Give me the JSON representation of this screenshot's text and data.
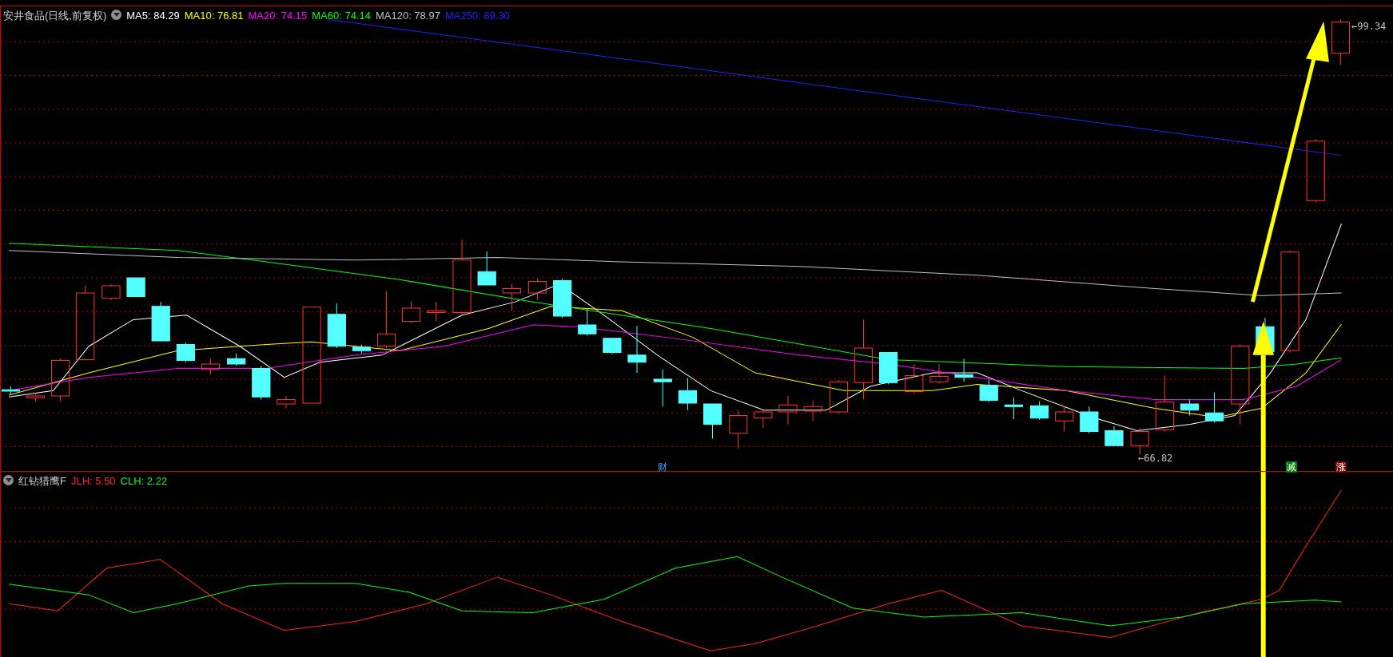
{
  "chart_title": "安井食品(日线,前复权)",
  "moving_averages": [
    {
      "label": "MA5: 84.29",
      "color": "#ffffff"
    },
    {
      "label": "MA10: 76.81",
      "color": "#ffff00"
    },
    {
      "label": "MA20: 74.15",
      "color": "#ff00ff"
    },
    {
      "label": "MA60: 74.14",
      "color": "#00ff00"
    },
    {
      "label": "MA120: 78.97",
      "color": "#c0c0c0"
    },
    {
      "label": "MA250: 89.30",
      "color": "#2020ff"
    }
  ],
  "price_labels": {
    "high": "←99.34",
    "low": "←66.82"
  },
  "event_markers": [
    {
      "label": "财",
      "kind": "finance"
    },
    {
      "label": "减",
      "kind": "reduce"
    },
    {
      "label": "涨",
      "kind": "rise"
    }
  ],
  "indicator": {
    "name": "红钻猎鹰F",
    "values": [
      {
        "label": "JLH: 5.50",
        "color": "#ff2020"
      },
      {
        "label": "CLH: 2.22",
        "color": "#00ff00"
      }
    ]
  }
}
